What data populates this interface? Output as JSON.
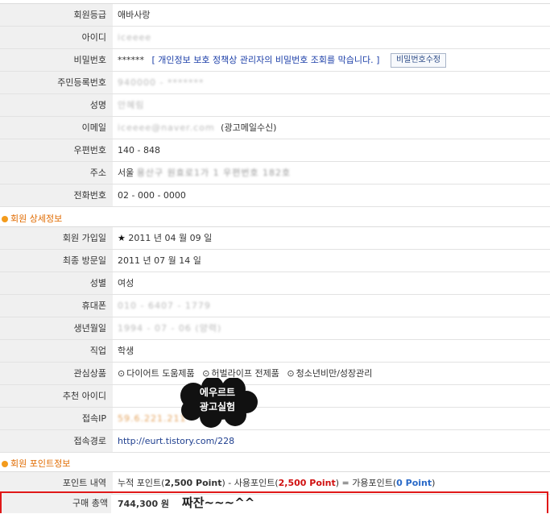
{
  "basic_info": [
    {
      "label": "회원등급",
      "value": "애바사랑"
    },
    {
      "label": "아이디",
      "value": "iceeee"
    },
    {
      "label": "비밀번호",
      "value": "******",
      "note": "[ 개인정보 보호 정책상 관리자의 비밀번호 조회를 막습니다. ]",
      "button": "비밀번호수정"
    },
    {
      "label": "주민등록번호",
      "value": "940000 - *******"
    },
    {
      "label": "성명",
      "value": "안혜림"
    },
    {
      "label": "이메일",
      "value": "iceeee@naver.com",
      "suffix": "(광고메일수신)"
    },
    {
      "label": "우편번호",
      "value": "140 - 848"
    },
    {
      "label": "주소",
      "prefix": "서울",
      "value": "용산구 원효로1가 1 우편번호 182호"
    },
    {
      "label": "전화번호",
      "value": "02 - 000 - 0000"
    }
  ],
  "detail_section_title": "회원 상세정보",
  "detail_info": {
    "join_label": "회원 가입일",
    "join_value": "2011 년 04 월 09 일",
    "visit_label": "최종 방문일",
    "visit_value": "2011 년 07 월 14 일",
    "gender_label": "성별",
    "gender_value": "여성",
    "phone_label": "휴대폰",
    "phone_value": "010 - 6407 - 1779",
    "birth_label": "생년월일",
    "birth_value": "1994 - 07 - 06 (양력)",
    "job_label": "직업",
    "job_value": "학생",
    "interest_label": "관심상품",
    "interests": [
      "다이어트 도움제품",
      "허벌라이프 전제품",
      "청소년비만/성장관리"
    ],
    "recommend_label": "추천 아이디",
    "recommend_value": "",
    "ip_label": "접속IP",
    "ip_value": "59.6.221.211",
    "route_label": "접속경로",
    "route_value": "http://eurt.tistory.com/228"
  },
  "overlay": {
    "line1": "에우르트",
    "line2": "광고실험"
  },
  "point_section_title": "회원 포인트정보",
  "points": {
    "label": "포인트 내역",
    "accum_prefix": "누적 포인트(",
    "accum_value": "2,500 Point",
    "accum_suffix": ") - 사용포인트(",
    "used_value": "2,500 Point",
    "used_suffix": ") = 가용포인트(",
    "avail_value": "0 Point",
    "avail_suffix": ")"
  },
  "purchase": {
    "label": "구매 총액",
    "value": "744,300 원",
    "note": "짜잔~~~^^"
  },
  "colors": {
    "section": "#e06b00",
    "highlight": "#e01818",
    "link": "#1f3f8f",
    "used_point": "#d01010",
    "avail_point": "#2a6ac8"
  }
}
